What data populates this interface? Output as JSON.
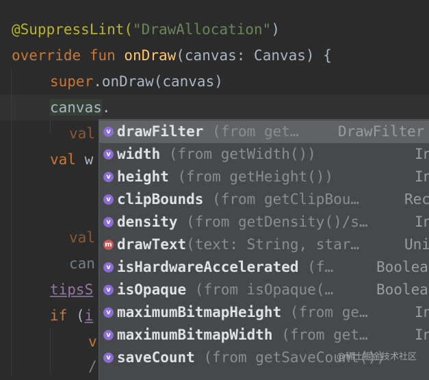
{
  "code": {
    "annotation_prefix": "@SuppressLint(",
    "annotation_arg": "\"DrawAllocation\"",
    "annotation_suffix": ")",
    "kw_override": "override",
    "kw_fun": "fun",
    "fn_name": "onDraw",
    "signature": "(canvas: Canvas) {",
    "kw_super": "super",
    "super_call": ".onDraw(canvas)",
    "canvas_word": "canvas",
    "dot": ".",
    "val_partial_1": "val",
    "val_partial_2_kw": "val",
    "val_partial_2_rest": " w",
    "val_partial_3": "val",
    "can_partial": "can",
    "tips_partial": "tipsS",
    "kw_if": "if",
    "if_rest": " (",
    "if_member": "i",
    "v_partial": "v",
    "slash_partial": "/"
  },
  "completion": {
    "items": [
      {
        "name": "drawFilter",
        "detail": " (from get…",
        "type": "DrawFilter",
        "kind": "property-icon",
        "selected": true
      },
      {
        "name": "width",
        "detail": " (from getWidth())",
        "type": "Int",
        "kind": "property-icon",
        "selected": false
      },
      {
        "name": "height",
        "detail": " (from getHeight())",
        "type": "Int",
        "kind": "property-icon",
        "selected": false
      },
      {
        "name": "clipBounds",
        "detail": " (from getClipBou…",
        "type": "Rect",
        "kind": "property-icon",
        "selected": false
      },
      {
        "name": "density",
        "detail": " (from getDensity()/s…",
        "type": "Int",
        "kind": "property-icon",
        "selected": false
      },
      {
        "name": "drawText",
        "detail": "(text: String, star…",
        "type": "Unit",
        "kind": "method-icon",
        "selected": false
      },
      {
        "name": "isHardwareAccelerated",
        "detail": " (f…",
        "type": "Boolean",
        "kind": "property-icon",
        "selected": false
      },
      {
        "name": "isOpaque",
        "detail": " (from isOpaque(…",
        "type": "Boolean",
        "kind": "property-icon",
        "selected": false
      },
      {
        "name": "maximumBitmapHeight",
        "detail": " (from ge…",
        "type": "Int",
        "kind": "property-icon",
        "selected": false
      },
      {
        "name": "maximumBitmapWidth",
        "detail": " (from get…",
        "type": "Int",
        "kind": "property-icon",
        "selected": false
      },
      {
        "name": "saveCount",
        "detail": " (from getSaveCount())",
        "type": "",
        "kind": "property-icon",
        "selected": false
      }
    ]
  },
  "icons": {
    "property_letter": "v",
    "method_letter": "m"
  },
  "watermark": "@稀土掘金技术社区"
}
